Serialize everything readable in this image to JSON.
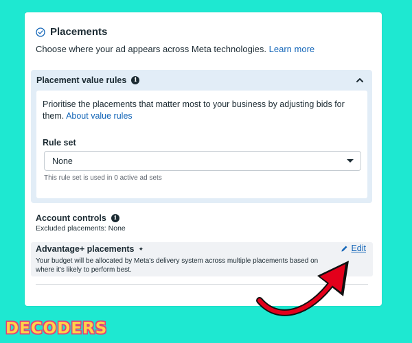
{
  "section": {
    "title": "Placements",
    "description": "Choose where your ad appears across Meta technologies.",
    "learn_more": "Learn more"
  },
  "value_rules": {
    "title": "Placement value rules",
    "info_icon": "i",
    "description": "Prioritise the placements that matter most to your business by adjusting bids for them.",
    "about_link": "About value rules",
    "rule_set_label": "Rule set",
    "rule_set_value": "None",
    "rule_set_help": "This rule set is used in 0 active ad sets"
  },
  "account_controls": {
    "title": "Account controls",
    "info_icon": "i",
    "excluded": "Excluded placements: None"
  },
  "advantage": {
    "title": "Advantage+ placements",
    "sparkle": "✦",
    "edit_label": "Edit",
    "description": "Your budget will be allocated by Meta's delivery system across multiple placements based on where it's likely to perform best."
  },
  "branding": {
    "logo": "DECODERS"
  },
  "colors": {
    "background": "#1ee8d1",
    "link": "#1466b8",
    "panel": "#e2edf7",
    "arrow": "#e3001b",
    "logo_fill": "#ffd24a",
    "logo_outline": "#e0407a"
  },
  "icons": [
    "check-circle-icon",
    "info-icon",
    "chevron-up-icon",
    "caret-down-icon",
    "sparkle-icon",
    "pencil-icon",
    "arrow-annotation"
  ]
}
